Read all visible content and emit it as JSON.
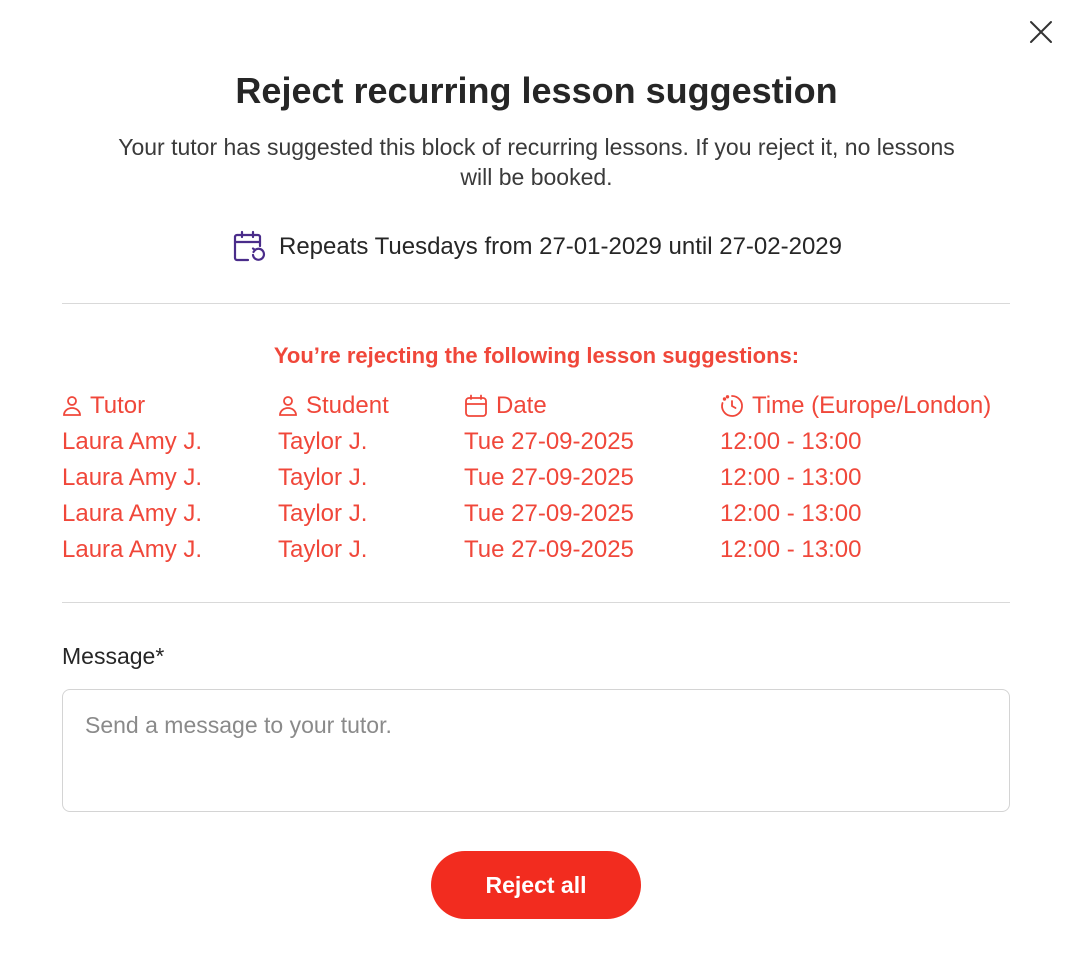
{
  "dialog": {
    "title": "Reject recurring lesson suggestion",
    "subtitle": "Your tutor has suggested this block of recurring lessons. If you reject it, no lessons will be booked.",
    "repeat_text": "Repeats Tuesdays from 27-01-2029 until 27-02-2029",
    "warning": "You’re rejecting the following lesson suggestions:"
  },
  "icons": {
    "close": "close-icon",
    "repeat": "calendar-repeat-icon",
    "person": "person-icon",
    "calendar": "calendar-icon",
    "clock": "clock-icon"
  },
  "colors": {
    "accent_red": "#f0473a",
    "button_red": "#f22c1f",
    "repeat_icon": "#4a2c8a"
  },
  "table": {
    "headers": {
      "tutor": "Tutor",
      "student": "Student",
      "date": "Date",
      "time": "Time (Europe/London)"
    },
    "rows": [
      {
        "tutor": "Laura Amy J.",
        "student": "Taylor J.",
        "date": "Tue 27-09-2025",
        "time": "12:00 - 13:00"
      },
      {
        "tutor": "Laura Amy J.",
        "student": "Taylor J.",
        "date": "Tue 27-09-2025",
        "time": "12:00 - 13:00"
      },
      {
        "tutor": "Laura Amy J.",
        "student": "Taylor J.",
        "date": "Tue 27-09-2025",
        "time": "12:00 - 13:00"
      },
      {
        "tutor": "Laura Amy J.",
        "student": "Taylor J.",
        "date": "Tue 27-09-2025",
        "time": "12:00 - 13:00"
      }
    ]
  },
  "message": {
    "label": "Message*",
    "value": "",
    "placeholder": "Send a message to your tutor."
  },
  "actions": {
    "reject_all": "Reject all"
  }
}
